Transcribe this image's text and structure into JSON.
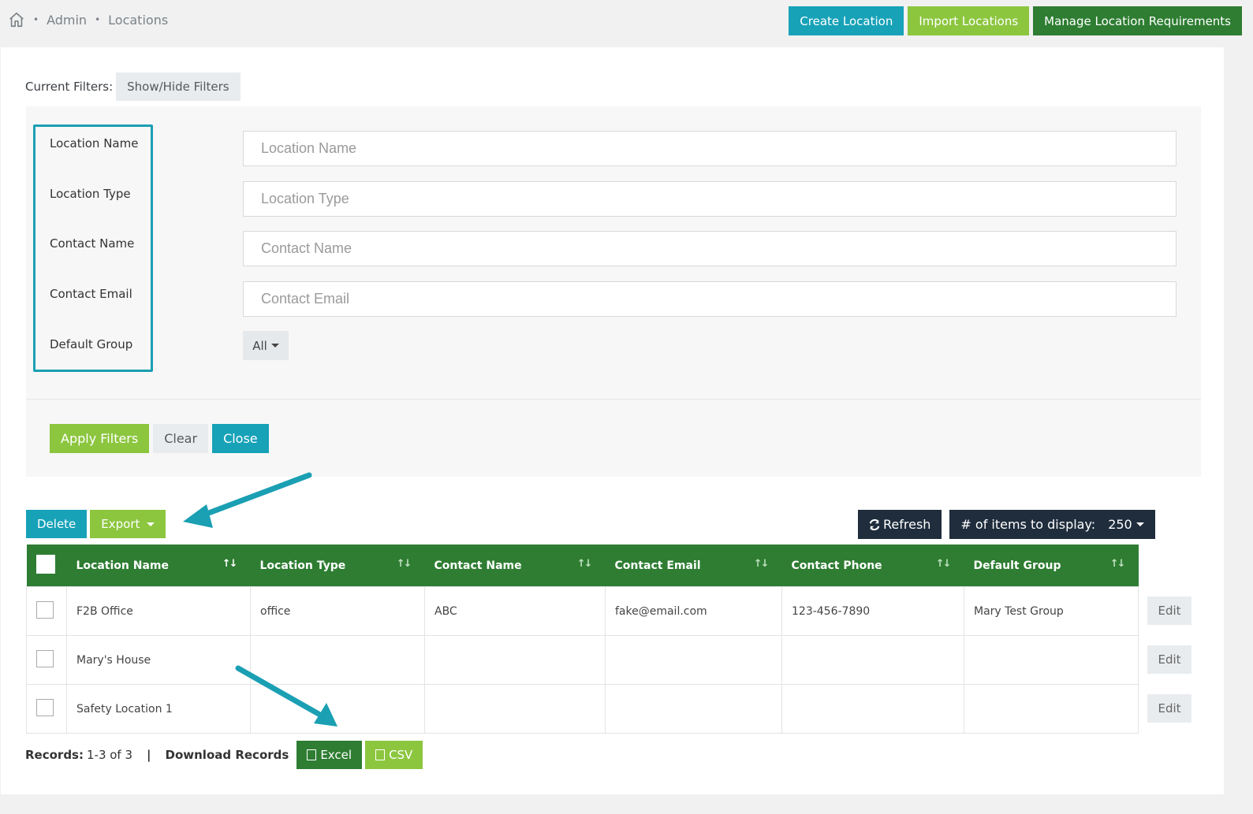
{
  "breadcrumb": {
    "home_icon": "home-icon",
    "items": [
      "Admin",
      "Locations"
    ]
  },
  "top_actions": {
    "create": "Create Location",
    "import": "Import Locations",
    "manage": "Manage Location Requirements"
  },
  "filters": {
    "current_label": "Current Filters:",
    "toggle": "Show/Hide Filters",
    "fields": [
      {
        "label": "Location Name",
        "placeholder": "Location Name"
      },
      {
        "label": "Location Type",
        "placeholder": "Location Type"
      },
      {
        "label": "Contact Name",
        "placeholder": "Contact Name"
      },
      {
        "label": "Contact Email",
        "placeholder": "Contact Email"
      }
    ],
    "default_group_label": "Default Group",
    "default_group_value": "All",
    "apply": "Apply Filters",
    "clear": "Clear",
    "close": "Close"
  },
  "toolbar": {
    "delete": "Delete",
    "export": "Export",
    "refresh": "Refresh",
    "items_label": "# of items to display:",
    "items_value": "250"
  },
  "table": {
    "columns": [
      "Location Name",
      "Location Type",
      "Contact Name",
      "Contact Email",
      "Contact Phone",
      "Default Group"
    ],
    "rows": [
      [
        "F2B Office",
        "office",
        "ABC",
        "fake@email.com",
        "123-456-7890",
        "Mary Test Group"
      ],
      [
        "Mary's House",
        "",
        "",
        "",
        "",
        ""
      ],
      [
        "Safety Location 1",
        "",
        "",
        "",
        "",
        ""
      ]
    ],
    "edit_label": "Edit"
  },
  "footer": {
    "records_label": "Records:",
    "records_value": "1-3 of 3",
    "separator": "|",
    "download_label": "Download Records",
    "excel": "Excel",
    "csv": "CSV"
  },
  "colors": {
    "teal": "#17a2b8",
    "lime": "#8cc63f",
    "dark_green": "#2e7d32",
    "navy": "#1f2d3d",
    "annotation": "#1a9fb3"
  }
}
